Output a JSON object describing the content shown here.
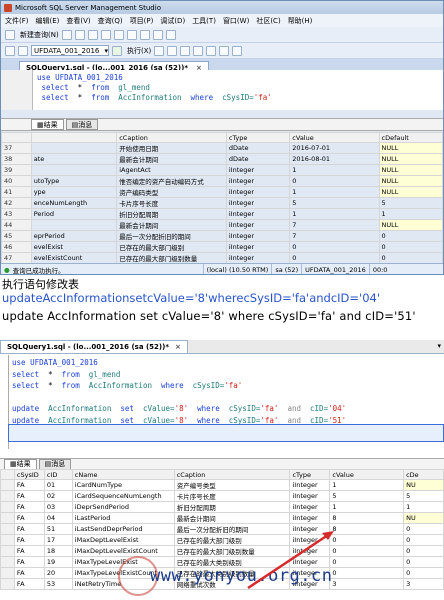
{
  "win1": {
    "title": "Microsoft SQL Server Management Studio",
    "menu": [
      "文件(F)",
      "编辑(E)",
      "查看(V)",
      "查询(Q)",
      "项目(P)",
      "调试(D)",
      "工具(T)",
      "窗口(W)",
      "社区(C)",
      "帮助(H)"
    ],
    "new_query": "新建查询(N)",
    "database": "UFDATA_001_2016",
    "execute": "执行(X)",
    "tab": "SQLQuery1.sql - (lo...001_2016 (sa (52))*",
    "code": {
      "line1": {
        "kw": "use",
        "rest": "UFDATA_001_2016"
      },
      "line2": {
        "kw1": "select",
        "star": "*",
        "kw2": "from",
        "table": "gl_mend"
      },
      "line3": {
        "kw1": "select",
        "star": "*",
        "kw2": "from",
        "table": "AccInformation",
        "kw3": "where",
        "col": "cSysID=",
        "val": "'fa'"
      }
    },
    "results_tab": "结果",
    "messages_tab": "消息",
    "grid": {
      "headers": [
        "",
        "",
        "cCaption",
        "cType",
        "cValue",
        "cDefault"
      ],
      "rows": [
        [
          "37",
          "",
          "开始使用日期",
          "dDate",
          "2016-07-01",
          "NULL"
        ],
        [
          "38",
          "ate",
          "最新会计期间",
          "dDate",
          "2016-08-01",
          "NULL"
        ],
        [
          "39",
          "",
          "iAgentAct",
          "iInteger",
          "1",
          "NULL"
        ],
        [
          "40",
          "utoType",
          "惟否编定的资产自动编码方式",
          "iInteger",
          "0",
          "NULL"
        ],
        [
          "41",
          "ype",
          "资产编码类型",
          "iInteger",
          "1",
          "NULL"
        ],
        [
          "42",
          "enceNumLength",
          "卡片序号长度",
          "iInteger",
          "5",
          "5"
        ],
        [
          "43",
          "Period",
          "折旧分配周期",
          "iInteger",
          "1",
          "1"
        ],
        [
          "44",
          "",
          "最新会计期间",
          "iInteger",
          "7",
          "NULL"
        ],
        [
          "45",
          "eprPeriod",
          "最后一次分配折旧的期间",
          "iInteger",
          "7",
          "0"
        ],
        [
          "46",
          "evelExist",
          "已存在的最大部门级别",
          "iInteger",
          "0",
          "0"
        ],
        [
          "47",
          "evelExistCount",
          "已存在的最大部门级别数量",
          "iInteger",
          "0",
          "0"
        ],
        [
          "48",
          "evelExist",
          "已存在的最大类别级别",
          "iInteger",
          "0",
          "0"
        ]
      ]
    },
    "status": {
      "message": "查询已成功执行。",
      "server": "(local) (10.50 RTM)",
      "user": "sa (52)",
      "db": "UFDATA_001_2016",
      "time": "00:0"
    }
  },
  "text": {
    "line1": "执行语句修改表",
    "line2": "updateAccInformationsetcValue='8'wherecSysID='fa'andcID='04'",
    "line3": "update AccInformation set cValue='8' where cSysID='fa' and cID='51'"
  },
  "win2": {
    "tab": "SQLQuery1.sql - (lo...001_2016 (sa (52))*",
    "code": {
      "line1": {
        "kw": "use",
        "rest": "UFDATA_001_2016"
      },
      "line2": {
        "kw1": "select",
        "star": "*",
        "kw2": "from",
        "table": "gl_mend"
      },
      "line3": {
        "kw1": "select",
        "star": "*",
        "kw2": "from",
        "table": "AccInformation",
        "kw3": "where",
        "col": "cSysID=",
        "val": "'fa'"
      },
      "line4": {
        "kw1": "update",
        "table": "AccInformation",
        "kw2": "set",
        "set": "cValue=",
        "v": "'8'",
        "kw3": "where",
        "col": "cSysID=",
        "cv": "'fa'",
        "and": "and",
        "id": "cID=",
        "iv": "'04'"
      },
      "line5": {
        "kw1": "update",
        "table": "AccInformation",
        "kw2": "set",
        "set": "cValue=",
        "v": "'8'",
        "kw3": "where",
        "col": "cSysID=",
        "cv": "'fa'",
        "and": "and",
        "id": "cID=",
        "iv": "'51'"
      }
    },
    "results_tab": "结果",
    "messages_tab": "消息",
    "grid": {
      "headers": [
        "",
        "cSysID",
        "cID",
        "cName",
        "cCaption",
        "cType",
        "cValue",
        "cDe"
      ],
      "rows": [
        [
          "",
          "FA",
          "01",
          "iCardNumType",
          "资产编号类型",
          "iInteger",
          "1",
          "NU"
        ],
        [
          "",
          "FA",
          "02",
          "iCardSequenceNumLength",
          "卡片序号长度",
          "iInteger",
          "5",
          "5"
        ],
        [
          "",
          "FA",
          "03",
          "iDeprSendPeriod",
          "折旧分配周期",
          "iInteger",
          "1",
          "1"
        ],
        [
          "",
          "FA",
          "04",
          "iLastPeriod",
          "最新会计期间",
          "iInteger",
          "8",
          "NU"
        ],
        [
          "",
          "FA",
          "51",
          "iLastSendDeprPeriod",
          "最后一次分配折旧的期间",
          "iInteger",
          "8",
          "0"
        ],
        [
          "",
          "FA",
          "17",
          "iMaxDeptLevelExist",
          "已存在的最大部门级别",
          "iInteger",
          "0",
          "0"
        ],
        [
          "",
          "FA",
          "18",
          "iMaxDeptLevelExistCount",
          "已存在的最大部门级别数量",
          "iInteger",
          "0",
          "0"
        ],
        [
          "",
          "FA",
          "19",
          "iMaxTypeLevelExist",
          "已存在的最大类别级别",
          "iInteger",
          "0",
          "0"
        ],
        [
          "",
          "FA",
          "20",
          "iMaxTypeLevelExistCount",
          "已存在的最大类别级别数量",
          "iInteger",
          "0",
          "0"
        ],
        [
          "",
          "FA",
          "53",
          "iNetRetryTime",
          "网络重试次数",
          "iInteger",
          "3",
          "3"
        ]
      ]
    },
    "watermark": "www.yonyou.org.cn"
  },
  "colors": {
    "keyword": "#1a3fd4",
    "string": "#d0201a",
    "table": "#1f7a7a",
    "link_text": "#2a55c9",
    "arrow": "#d62b2b"
  }
}
